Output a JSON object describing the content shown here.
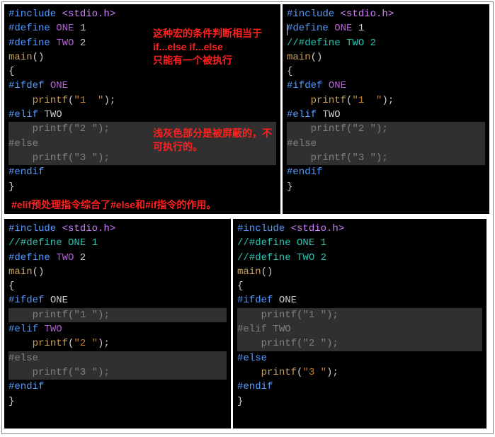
{
  "panels": {
    "p1": {
      "include": "#include",
      "header": "<stdio.h>",
      "def1_dir": "#define",
      "def1_name": "ONE",
      "def1_val": "1",
      "def2_dir": "#define",
      "def2_name": "TWO",
      "def2_val": "2",
      "main": "main",
      "parens": "()",
      "lbrace": "{",
      "ifdef_dir": "#ifdef",
      "ifdef_mac": "ONE",
      "printf1_fn": "printf",
      "printf1_arg": "\"1  \"",
      "elif_dir": "#elif",
      "elif_mac": "TWO",
      "printf2_fn": "printf",
      "printf2_arg": "\"2 \"",
      "else_dir": "#else",
      "printf3_fn": "printf",
      "printf3_arg": "\"3 \"",
      "endif_dir": "#endif",
      "rbrace": "}"
    },
    "p2": {
      "include": "#include",
      "header": "<stdio.h>",
      "def1_dir": "#define",
      "def1_name": "ONE",
      "def1_val": "1",
      "def2_comment": "//#define TWO 2",
      "main": "main",
      "parens": "()",
      "lbrace": "{",
      "ifdef_dir": "#ifdef",
      "ifdef_mac": "ONE",
      "printf1_fn": "printf",
      "printf1_arg": "\"1  \"",
      "elif_dir": "#elif",
      "elif_mac": "TWO",
      "printf2_fn": "printf",
      "printf2_arg": "\"2 \"",
      "else_dir": "#else",
      "printf3_fn": "printf",
      "printf3_arg": "\"3 \"",
      "endif_dir": "#endif",
      "rbrace": "}"
    },
    "p3": {
      "include": "#include",
      "header": "<stdio.h>",
      "def1_comment": "//#define ONE 1",
      "def2_dir": "#define",
      "def2_name": "TWO",
      "def2_val": "2",
      "main": "main",
      "parens": "()",
      "lbrace": "{",
      "ifdef_dir": "#ifdef",
      "ifdef_mac": "ONE",
      "printf1_fn": "printf",
      "printf1_arg": "\"1 \"",
      "elif_dir": "#elif",
      "elif_mac": "TWO",
      "printf2_fn": "printf",
      "printf2_arg": "\"2 \"",
      "else_dir": "#else",
      "printf3_fn": "printf",
      "printf3_arg": "\"3 \"",
      "endif_dir": "#endif",
      "rbrace": "}"
    },
    "p4": {
      "include": "#include",
      "header": "<stdio.h>",
      "def1_comment": "//#define ONE 1",
      "def2_comment": "//#define TWO 2",
      "main": "main",
      "parens": "()",
      "lbrace": "{",
      "ifdef_dir": "#ifdef",
      "ifdef_mac": "ONE",
      "printf1_fn": "printf",
      "printf1_arg": "\"1 \"",
      "elif_dir": "#elif",
      "elif_mac": "TWO",
      "printf2_fn": "printf",
      "printf2_arg": "\"2 \"",
      "else_dir": "#else",
      "printf3_fn": "printf",
      "printf3_arg": "\"3 \"",
      "endif_dir": "#endif",
      "rbrace": "}"
    }
  },
  "annotations": {
    "note1": "这种宏的条件判断相当于\nif...else if...else\n只能有一个被执行",
    "note2": "浅灰色部分是被屏蔽的，不可执行的。",
    "note3": "#elif预处理指令综合了#else和#if指令的作用。"
  }
}
